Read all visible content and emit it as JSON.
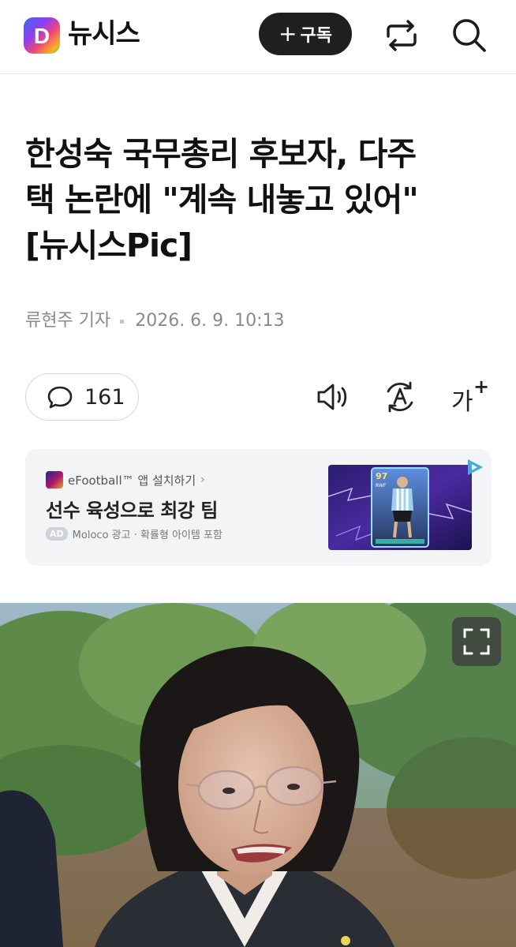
{
  "header": {
    "logo_letter": "D",
    "brand": "뉴시스",
    "subscribe_label": "구독",
    "icons": [
      "logo-icon",
      "share-icon",
      "search-icon"
    ]
  },
  "article": {
    "headline_lines": [
      "한성숙 국무총리 후보자, 다주",
      "택 논란에 \"계속 내놓고 있어\"",
      "[뉴시스Pic]"
    ],
    "reporter": "류현주 기자",
    "date": "2026. 6. 9. 10:13"
  },
  "actions": {
    "comment_count": "161",
    "icons": [
      "comment-icon",
      "speaker-icon",
      "translate-icon",
      "font-size-icon"
    ]
  },
  "ad": {
    "app_name": "eFootball™ 앱 설치하기",
    "chevron": "›",
    "title": "선수 육성으로 최강 팀",
    "badge": "AD",
    "meta": "Moloco 광고 · 확률형 아이템 포함",
    "card_rating": "97",
    "card_position": "RWF"
  },
  "colors": {
    "subscribe_bg": "#1f1f1f",
    "ad_bg": "#f3f4f6",
    "byline": "#8a8a8a"
  }
}
